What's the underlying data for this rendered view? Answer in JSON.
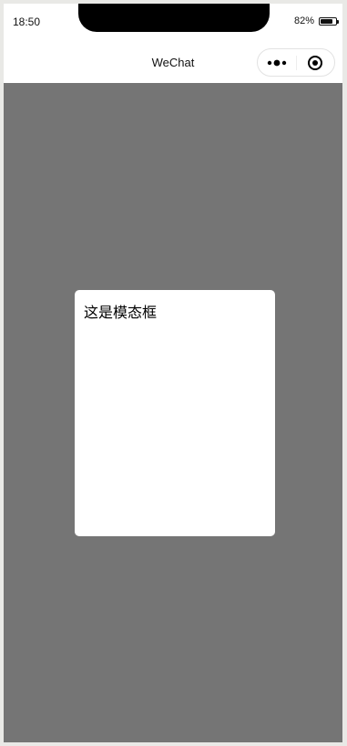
{
  "status_bar": {
    "time": "18:50",
    "battery_percent": "82%",
    "battery_level": 0.82
  },
  "nav": {
    "title": "WeChat",
    "capsule": {
      "more_icon": "more-dots-icon",
      "close_icon": "target-close-icon"
    }
  },
  "modal": {
    "text": "这是模态框"
  },
  "colors": {
    "overlay": "#757575",
    "modal_background": "#ffffff",
    "nav_background": "#ffffff"
  }
}
